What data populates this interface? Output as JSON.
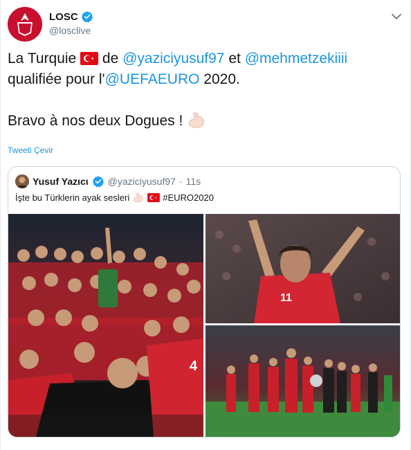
{
  "author": {
    "display_name": "LOSC",
    "handle": "@losclive",
    "avatar_label": "LOSC"
  },
  "tweet": {
    "t1": "La Turquie ",
    "t2": " de ",
    "mention1": "@yaziciyusuf97",
    "t3": " et ",
    "mention2": "@mehmetzekiiii",
    "t4": " qualifiée pour l'",
    "mention3": "@UEFAEURO",
    "t5": " 2020.",
    "t6": "Bravo à nos deux Dogues ! "
  },
  "translate_label": "Tweeti Çevir",
  "quoted": {
    "display_name": "Yusuf Yazıcı",
    "handle": "@yaziciyusuf97",
    "dot": "·",
    "time": "11s",
    "text": "İşte bu Türklerin ayak sesleri",
    "hashtag": "#EURO2020",
    "photo_captions": {
      "jersey_number": "11",
      "player_number": "4"
    }
  },
  "colors": {
    "brand_red": "#c8102e",
    "link_blue": "#1b95e0",
    "verified_blue": "#1da1f2",
    "turkey_red": "#e30a17"
  },
  "icons": [
    "verified-badge-icon",
    "chevron-down-icon",
    "turkey-flag-icon",
    "flexed-biceps-icon"
  ]
}
